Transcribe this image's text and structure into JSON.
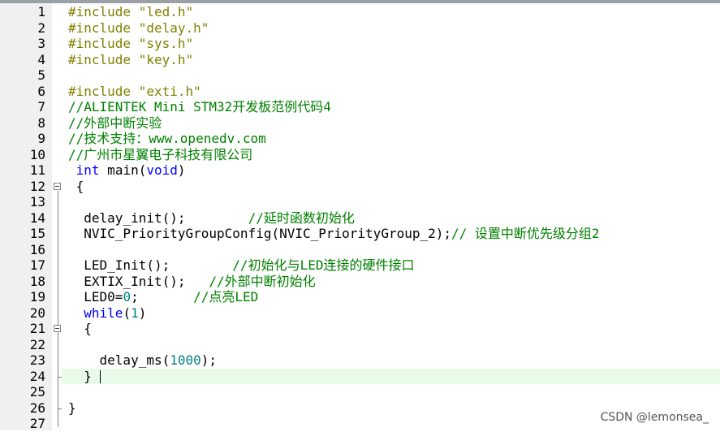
{
  "editor": {
    "active_line": 24,
    "lines": [
      {
        "n": "1",
        "segs": [
          {
            "t": "#include ",
            "c": "pre"
          },
          {
            "t": "\"led.h\"",
            "c": "str"
          }
        ]
      },
      {
        "n": "2",
        "segs": [
          {
            "t": "#include ",
            "c": "pre"
          },
          {
            "t": "\"delay.h\"",
            "c": "str"
          }
        ]
      },
      {
        "n": "3",
        "segs": [
          {
            "t": "#include ",
            "c": "pre"
          },
          {
            "t": "\"sys.h\"",
            "c": "str"
          }
        ]
      },
      {
        "n": "4",
        "segs": [
          {
            "t": "#include ",
            "c": "pre"
          },
          {
            "t": "\"key.h\"",
            "c": "str"
          }
        ]
      },
      {
        "n": "5",
        "segs": []
      },
      {
        "n": "6",
        "segs": [
          {
            "t": "#include ",
            "c": "pre"
          },
          {
            "t": "\"exti.h\"",
            "c": "str"
          }
        ]
      },
      {
        "n": "7",
        "segs": [
          {
            "t": "//ALIENTEK Mini STM32开发板范例代码4",
            "c": "cmt"
          }
        ]
      },
      {
        "n": "8",
        "segs": [
          {
            "t": "//外部中断实验",
            "c": "cmt"
          }
        ]
      },
      {
        "n": "9",
        "segs": [
          {
            "t": "//技术支持：www.openedv.com",
            "c": "cmt"
          }
        ]
      },
      {
        "n": "10",
        "segs": [
          {
            "t": "//广州市星翼电子科技有限公司",
            "c": "cmt"
          }
        ]
      },
      {
        "n": "11",
        "segs": [
          {
            "t": " ",
            "c": "def"
          },
          {
            "t": "int",
            "c": "kw"
          },
          {
            "t": " main(",
            "c": "def"
          },
          {
            "t": "void",
            "c": "kw"
          },
          {
            "t": ")",
            "c": "def"
          }
        ]
      },
      {
        "n": "12",
        "segs": [
          {
            "t": " {",
            "c": "def"
          }
        ]
      },
      {
        "n": "13",
        "segs": []
      },
      {
        "n": "14",
        "segs": [
          {
            "t": "  delay_init();        ",
            "c": "def"
          },
          {
            "t": "//延时函数初始化",
            "c": "cmt"
          }
        ]
      },
      {
        "n": "15",
        "segs": [
          {
            "t": "  NVIC_PriorityGroupConfig(NVIC_PriorityGroup_2);",
            "c": "def"
          },
          {
            "t": "// 设置中断优先级分组2",
            "c": "cmt"
          }
        ]
      },
      {
        "n": "16",
        "segs": []
      },
      {
        "n": "17",
        "segs": [
          {
            "t": "  LED_Init();        ",
            "c": "def"
          },
          {
            "t": "//初始化与LED连接的硬件接口",
            "c": "cmt"
          }
        ]
      },
      {
        "n": "18",
        "segs": [
          {
            "t": "  EXTIX_Init();   ",
            "c": "def"
          },
          {
            "t": "//外部中断初始化",
            "c": "cmt"
          }
        ]
      },
      {
        "n": "19",
        "segs": [
          {
            "t": "  LED0=",
            "c": "def"
          },
          {
            "t": "0",
            "c": "num"
          },
          {
            "t": ";       ",
            "c": "def"
          },
          {
            "t": "//点亮LED",
            "c": "cmt"
          }
        ]
      },
      {
        "n": "20",
        "segs": [
          {
            "t": "  ",
            "c": "def"
          },
          {
            "t": "while",
            "c": "kw"
          },
          {
            "t": "(",
            "c": "def"
          },
          {
            "t": "1",
            "c": "num"
          },
          {
            "t": ")",
            "c": "def"
          }
        ]
      },
      {
        "n": "21",
        "segs": [
          {
            "t": "  {",
            "c": "def"
          }
        ]
      },
      {
        "n": "22",
        "segs": []
      },
      {
        "n": "23",
        "segs": [
          {
            "t": "    delay_ms(",
            "c": "def"
          },
          {
            "t": "1000",
            "c": "num"
          },
          {
            "t": ");",
            "c": "def"
          }
        ]
      },
      {
        "n": "24",
        "segs": [
          {
            "t": "  } ",
            "c": "def"
          }
        ]
      },
      {
        "n": "25",
        "segs": []
      },
      {
        "n": "26",
        "segs": [
          {
            "t": "}",
            "c": "def"
          }
        ]
      },
      {
        "n": "27",
        "segs": []
      }
    ]
  },
  "watermark": "CSDN @lemonsea_"
}
